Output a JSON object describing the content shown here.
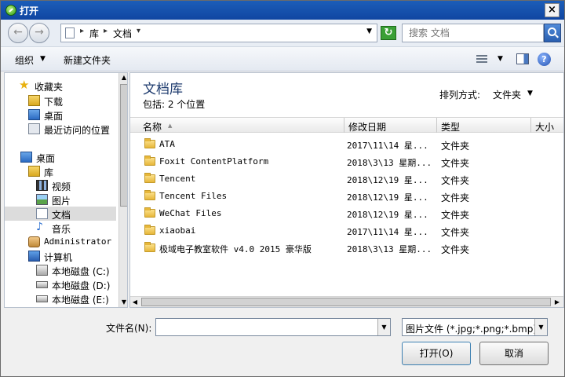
{
  "window": {
    "title": "打开",
    "close_glyph": "×"
  },
  "address": {
    "crumbs": [
      "库",
      "文档"
    ],
    "back_glyph": "←",
    "forward_glyph": "→",
    "refresh_glyph": "↻",
    "search_placeholder": "搜索 文档"
  },
  "toolbar": {
    "organize": "组织",
    "new_folder": "新建文件夹",
    "help": "?"
  },
  "nav": {
    "items": [
      {
        "label": "收藏夹",
        "icon": "star-icon"
      },
      {
        "label": "下载",
        "icon": "download-folder-icon"
      },
      {
        "label": "桌面",
        "icon": "desktop-icon"
      },
      {
        "label": "最近访问的位置",
        "icon": "recent-places-icon"
      },
      {
        "label": "桌面",
        "icon": "desktop-icon"
      },
      {
        "label": "库",
        "icon": "library-icon"
      },
      {
        "label": "视频",
        "icon": "video-library-icon"
      },
      {
        "label": "图片",
        "icon": "pictures-library-icon"
      },
      {
        "label": "文档",
        "icon": "documents-library-icon"
      },
      {
        "label": "音乐",
        "icon": "music-library-icon"
      },
      {
        "label": "Administrator",
        "icon": "user-folder-icon"
      },
      {
        "label": "计算机",
        "icon": "computer-icon"
      },
      {
        "label": "本地磁盘 (C:)",
        "icon": "system-drive-icon"
      },
      {
        "label": "本地磁盘 (D:)",
        "icon": "drive-icon"
      },
      {
        "label": "本地磁盘 (E:)",
        "icon": "drive-icon"
      }
    ]
  },
  "library": {
    "title": "文档库",
    "subtitle": "包括: 2 个位置",
    "arrange_label": "排列方式:",
    "arrange_value": "文件夹"
  },
  "columns": {
    "name": "名称",
    "date": "修改日期",
    "type": "类型",
    "size": "大小"
  },
  "files": [
    {
      "name": "ATA",
      "date": "2017\\11\\14 星...",
      "type": "文件夹"
    },
    {
      "name": "Foxit ContentPlatform",
      "date": "2018\\3\\13 星期...",
      "type": "文件夹"
    },
    {
      "name": "Tencent",
      "date": "2018\\12\\19 星...",
      "type": "文件夹"
    },
    {
      "name": "Tencent Files",
      "date": "2018\\12\\19 星...",
      "type": "文件夹"
    },
    {
      "name": "WeChat Files",
      "date": "2018\\12\\19 星...",
      "type": "文件夹"
    },
    {
      "name": "xiaobai",
      "date": "2017\\11\\14 星...",
      "type": "文件夹"
    },
    {
      "name": "极域电子教室软件 v4.0 2015 豪华版",
      "date": "2018\\3\\13 星期...",
      "type": "文件夹"
    }
  ],
  "footer": {
    "filename_label": "文件名(N):",
    "filename_value": "",
    "filter": "图片文件 (*.jpg;*.png;*.bmp)",
    "open_button": "打开(O)",
    "cancel_button": "取消"
  }
}
